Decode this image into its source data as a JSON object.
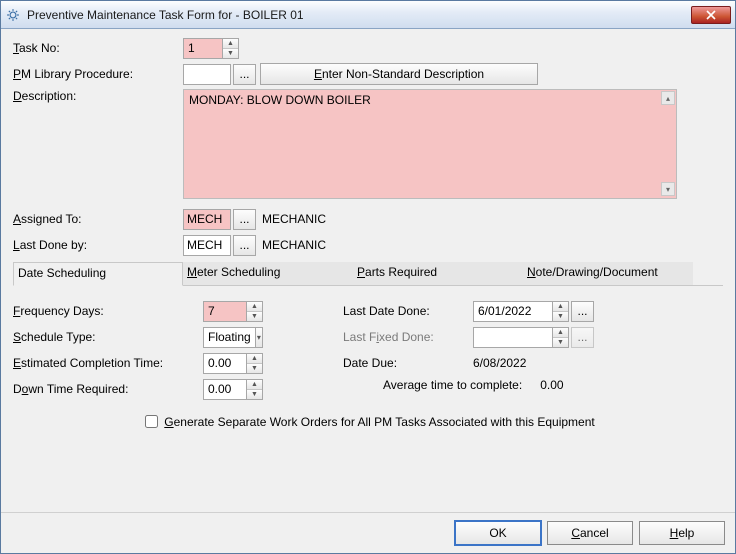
{
  "window": {
    "title": "Preventive Maintenance Task Form for - BOILER 01"
  },
  "labels": {
    "task_no": "Task No:",
    "pm_library": "PM Library Procedure:",
    "description": "Description:",
    "assigned_to": "Assigned To:",
    "last_done_by": "Last Done by:",
    "freq_days": "Frequency Days:",
    "schedule_type": "Schedule Type:",
    "ect": "Estimated Completion Time:",
    "down_time": "Down Time Required:",
    "last_date_done": "Last Date Done:",
    "last_fixed_done": "Last Fixed Done:",
    "date_due": "Date Due:",
    "avg_time": "Average time to complete:",
    "generate_sep": "Generate Separate Work Orders for All PM Tasks Associated with this Equipment",
    "enter_nonstd": "Enter Non-Standard Description",
    "ok": "OK",
    "cancel": "Cancel",
    "help": "Help",
    "ellipsis": "...",
    "mechanic": "MECHANIC"
  },
  "tabs": [
    "Date Scheduling",
    "Meter Scheduling",
    "Parts Required",
    "Note/Drawing/Document"
  ],
  "values": {
    "task_no": "1",
    "pm_library": "",
    "description": "MONDAY: BLOW DOWN BOILER",
    "assigned_to": "MECH",
    "last_done_by": "MECH",
    "freq_days": "7",
    "schedule_type": "Floating",
    "ect": "0.00",
    "down_time": "0.00",
    "last_date_done": "6/01/2022",
    "last_fixed_done": "",
    "date_due": "6/08/2022",
    "avg_time": "0.00"
  }
}
